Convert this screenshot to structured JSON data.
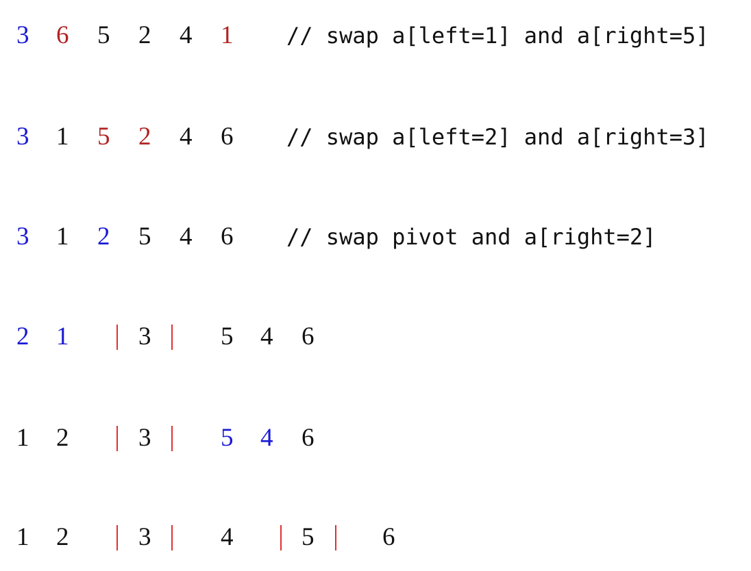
{
  "colors": {
    "default": "#111111",
    "pivot": "#1a1ad6",
    "swap": "#b22222",
    "divider": "#e03030"
  },
  "steps": [
    {
      "tokens": [
        {
          "text": "3",
          "role": "pivot"
        },
        {
          "text": "6",
          "role": "swap"
        },
        {
          "text": "5",
          "role": "default"
        },
        {
          "text": "2",
          "role": "default"
        },
        {
          "text": "4",
          "role": "default"
        },
        {
          "text": "1",
          "role": "swap"
        }
      ],
      "comment": "// swap a[left=1] and a[right=5]"
    },
    {
      "tokens": [
        {
          "text": "3",
          "role": "pivot"
        },
        {
          "text": "1",
          "role": "default"
        },
        {
          "text": "5",
          "role": "swap"
        },
        {
          "text": "2",
          "role": "swap"
        },
        {
          "text": "4",
          "role": "default"
        },
        {
          "text": "6",
          "role": "default"
        }
      ],
      "comment": "// swap a[left=2] and a[right=3]"
    },
    {
      "tokens": [
        {
          "text": "3",
          "role": "pivot"
        },
        {
          "text": "1",
          "role": "default"
        },
        {
          "text": "2",
          "role": "pivot"
        },
        {
          "text": "5",
          "role": "default"
        },
        {
          "text": "4",
          "role": "default"
        },
        {
          "text": "6",
          "role": "default"
        }
      ],
      "comment": "// swap pivot and a[right=2]"
    },
    {
      "tokens": [
        {
          "text": "2",
          "role": "pivot"
        },
        {
          "text": "1",
          "role": "pivot"
        },
        {
          "text": "3",
          "role": "default",
          "bracketed": true
        },
        {
          "text": "5",
          "role": "default"
        },
        {
          "text": "4",
          "role": "default"
        },
        {
          "text": "6",
          "role": "default"
        }
      ],
      "comment": ""
    },
    {
      "tokens": [
        {
          "text": "1",
          "role": "default"
        },
        {
          "text": "2",
          "role": "default"
        },
        {
          "text": "3",
          "role": "default",
          "bracketed": true
        },
        {
          "text": "5",
          "role": "pivot"
        },
        {
          "text": "4",
          "role": "pivot"
        },
        {
          "text": "6",
          "role": "default"
        }
      ],
      "comment": ""
    },
    {
      "tokens": [
        {
          "text": "1",
          "role": "default"
        },
        {
          "text": "2",
          "role": "default"
        },
        {
          "text": "3",
          "role": "default",
          "bracketed": true
        },
        {
          "text": "4",
          "role": "default"
        },
        {
          "text": "5",
          "role": "default",
          "bracketed": true
        },
        {
          "text": "6",
          "role": "default"
        }
      ],
      "comment": ""
    }
  ]
}
